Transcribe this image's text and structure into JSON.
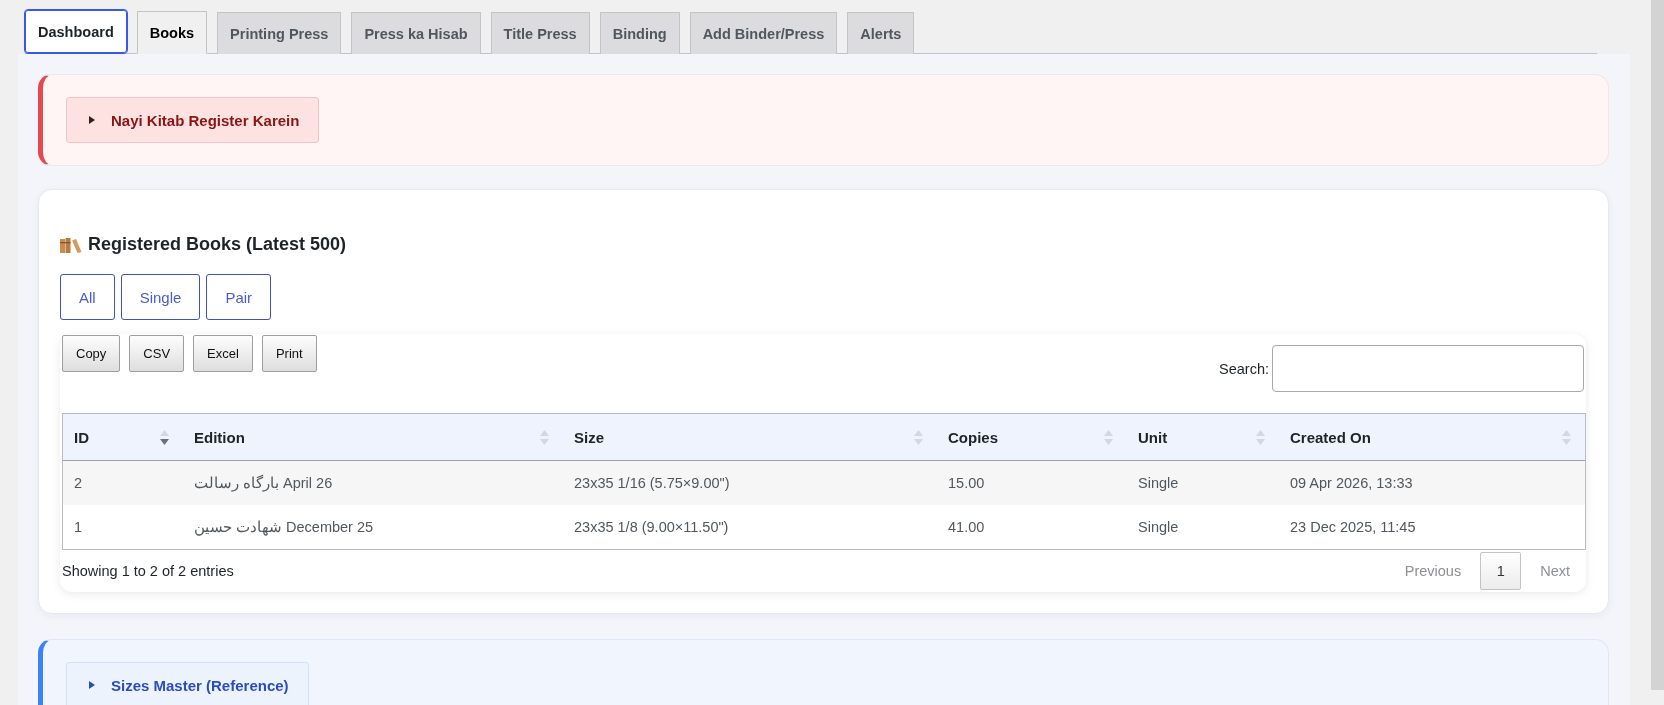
{
  "tabs": [
    {
      "label": "Dashboard",
      "selected": false,
      "focused": true
    },
    {
      "label": "Books",
      "selected": true,
      "focused": false
    },
    {
      "label": "Printing Press",
      "selected": false,
      "focused": false
    },
    {
      "label": "Press ka Hisab",
      "selected": false,
      "focused": false
    },
    {
      "label": "Title Press",
      "selected": false,
      "focused": false
    },
    {
      "label": "Binding",
      "selected": false,
      "focused": false
    },
    {
      "label": "Add Binder/Press",
      "selected": false,
      "focused": false
    },
    {
      "label": "Alerts",
      "selected": false,
      "focused": false
    }
  ],
  "register_panel": {
    "kind": "danger",
    "toggle": {
      "label": "Nayi Kitab Register Karein",
      "expanded": false
    }
  },
  "registered_books": {
    "title": "Registered Books (Latest 500)",
    "filters": [
      "All",
      "Single",
      "Pair"
    ],
    "export_buttons": [
      "Copy",
      "CSV",
      "Excel",
      "Print"
    ],
    "search": {
      "label": "Search:"
    },
    "table": {
      "columns": [
        {
          "label": "ID",
          "sorted_ascending": false,
          "sorted_descending": true
        },
        {
          "label": "Edition",
          "sorted_ascending": false,
          "sorted_descending": false
        },
        {
          "label": "Size",
          "sorted_ascending": false,
          "sorted_descending": false
        },
        {
          "label": "Copies",
          "sorted_ascending": false,
          "sorted_descending": false
        },
        {
          "label": "Unit",
          "sorted_ascending": false,
          "sorted_descending": false
        },
        {
          "label": "Created On",
          "sorted_ascending": false,
          "sorted_descending": false
        }
      ],
      "rows": [
        [
          "2",
          "بارگاه رسالت April 26",
          "23x35 1/16 (5.75×9.00\")",
          "15.00",
          "Single",
          "09 Apr 2026, 13:33"
        ],
        [
          "1",
          "شهادت حسین December 25",
          "23x35 1/8 (9.00×11.50\")",
          "41.00",
          "Single",
          "23 Dec 2025, 11:45"
        ]
      ]
    },
    "info": "Showing 1 to 2 of 2 entries",
    "pagination": {
      "previous": {
        "label": "Previous",
        "disabled": true
      },
      "pages": [
        {
          "label": "1",
          "selected": true
        }
      ],
      "next": {
        "label": "Next",
        "disabled": true
      }
    }
  },
  "sizes_panel": {
    "kind": "info",
    "toggle": {
      "label": "Sizes Master (Reference)",
      "expanded": false
    }
  }
}
